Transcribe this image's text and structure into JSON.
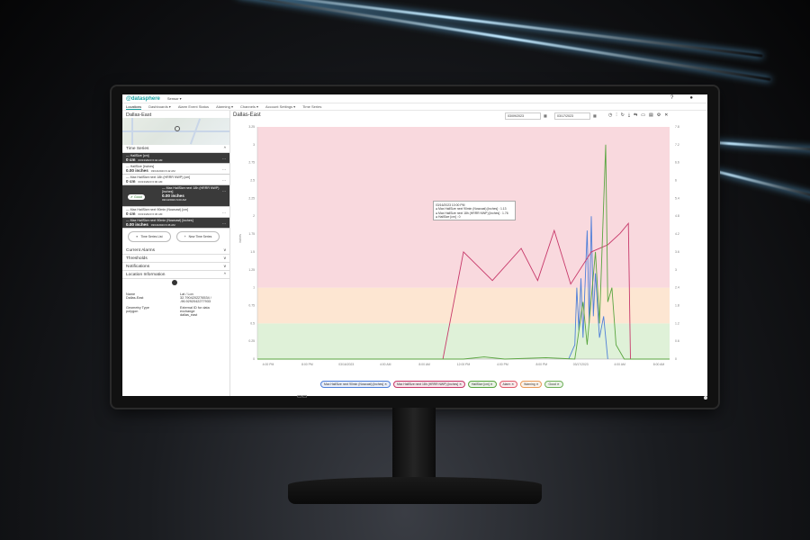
{
  "app": {
    "logo": "@datasphere",
    "sensor_select": "Sensor ▾",
    "help_icon": "?",
    "user_icon": "user-icon"
  },
  "nav": [
    "Locations",
    "Dashboards ▾",
    "Alarm Event Status",
    "Alarming ▾",
    "Channels ▾",
    "Account Settings ▾",
    "Time Series"
  ],
  "sidebar": {
    "location_title": "Dallas-East",
    "time_series_header": "Time Series",
    "items": [
      {
        "name": "— HailSize [cm]",
        "value": "0 cm",
        "time": "03/13/2023 6:42 AM",
        "dark": true
      },
      {
        "name": "— HailSize [inches]",
        "value": "0.00 inches",
        "time": "03/13/2023 6:42 AM",
        "dark": false
      },
      {
        "name": "— Max HailSize next 18h (HRRR NWP) [cm]",
        "value": "0 cm",
        "time": "03/13/2023 6:00 AM",
        "dark": false
      },
      {
        "name": "— Max HailSize next 18h (HRRR NWP) [inches]",
        "value": "0.00 inches",
        "time": "03/13/2023 6:00 AM",
        "dark": true,
        "badge": "Good"
      },
      {
        "name": "— Max HailSize next 90min (Nowcast) [cm]",
        "value": "0 cm",
        "time": "03/13/2023 6:36 AM",
        "dark": false
      },
      {
        "name": "— Max HailSize next 90min (Nowcast) [inches]",
        "value": "0.00 inches",
        "time": "03/13/2023 6:36 AM",
        "dark": true
      }
    ],
    "btn_list": "Time Series List",
    "btn_new": "New Time Series",
    "sections": [
      "Current Alarms",
      "Thresholds",
      "Notifications",
      "Location Information"
    ],
    "loc_info": {
      "name_label": "Name",
      "name_value": "Dallas-East",
      "latlon_label": "Lat / Lon",
      "latlon_value": "32.7904202276534 / -96.9292042277933",
      "geom_label": "Geometry Type",
      "geom_value": "polygon",
      "extid_label": "External ID for data exchange",
      "extid_value": "dallas_east"
    }
  },
  "main": {
    "title": "Dallas-East",
    "date_from": "03/09/2023",
    "date_to": "03/17/2023",
    "tooltip": {
      "line1": "03/16/2023 10:00 PM",
      "line2": "● Max HailSize next 90min (Nowcast) [inches] : 1.13",
      "line3": "● Max HailSize next 18h (HRRR NWP) [inches] : 1.76",
      "line4": "● HailSize [cm] : 0"
    }
  },
  "chart_data": {
    "type": "line",
    "x": [
      "4:00 PM",
      "8:00 PM",
      "03/16/2023",
      "4:00 AM",
      "8:00 AM",
      "12:00 PM",
      "4:00 PM",
      "8:00 PM",
      "03/17/2023",
      "4:00 AM",
      "8:00 AM"
    ],
    "left_y_ticks": [
      "0",
      "0.25",
      "0.5",
      "0.75",
      "1",
      "1.25",
      "1.5",
      "1.75",
      "2",
      "2.25",
      "2.5",
      "2.75",
      "3",
      "3.25"
    ],
    "right_y_ticks": [
      "0",
      "0.6",
      "1.2",
      "1.8",
      "2.4",
      "3",
      "3.6",
      "4.2",
      "4.8",
      "5.4",
      "6",
      "6.6",
      "7.2",
      "7.8"
    ],
    "ylabel": "inches",
    "bands": [
      {
        "name": "Good",
        "from": 0,
        "to": 0.5,
        "color": "#dff1d8"
      },
      {
        "name": "Warning",
        "from": 0.5,
        "to": 1,
        "color": "#fde6d2"
      },
      {
        "name": "Alarm",
        "from": 1,
        "to": 3.25,
        "color": "#f9d9de"
      }
    ],
    "series": [
      {
        "name": "Max HailSize next 90min (Nowcast) [inches]",
        "color": "#4f7fd8",
        "points": [
          [
            0.755,
            0
          ],
          [
            0.77,
            0.2
          ],
          [
            0.775,
            1.0
          ],
          [
            0.78,
            0.4
          ],
          [
            0.785,
            1.13
          ],
          [
            0.79,
            0.3
          ],
          [
            0.8,
            1.8
          ],
          [
            0.805,
            0.5
          ],
          [
            0.81,
            2.0
          ],
          [
            0.815,
            0.6
          ],
          [
            0.82,
            1.2
          ],
          [
            0.83,
            0.3
          ],
          [
            0.84,
            0.6
          ],
          [
            0.85,
            0
          ]
        ]
      },
      {
        "name": "Max HailSize next 18h (HRRR NWP) [inches]",
        "color": "#c7396a",
        "points": [
          [
            0.45,
            0
          ],
          [
            0.5,
            1.5
          ],
          [
            0.57,
            1.1
          ],
          [
            0.64,
            1.55
          ],
          [
            0.68,
            1.1
          ],
          [
            0.72,
            1.8
          ],
          [
            0.76,
            1.05
          ],
          [
            0.81,
            1.5
          ],
          [
            0.85,
            1.6
          ],
          [
            0.88,
            1.76
          ],
          [
            0.9,
            1.9
          ],
          [
            0.905,
            0
          ]
        ]
      },
      {
        "name": "HailSize [cm]",
        "color": "#5aa540",
        "points": [
          [
            0.0,
            0
          ],
          [
            0.5,
            0
          ],
          [
            0.55,
            0.03
          ],
          [
            0.6,
            0
          ],
          [
            0.7,
            0.02
          ],
          [
            0.77,
            0
          ],
          [
            0.79,
            0.8
          ],
          [
            0.8,
            0.2
          ],
          [
            0.82,
            1.5
          ],
          [
            0.83,
            0.5
          ],
          [
            0.845,
            3.0
          ],
          [
            0.85,
            0.8
          ],
          [
            0.86,
            1.0
          ],
          [
            0.87,
            0.2
          ],
          [
            0.89,
            0
          ],
          [
            1.0,
            0
          ]
        ]
      }
    ],
    "legend": [
      "Max HailSize next 90min (Nowcast) [inches]",
      "Max HailSize next 18h (HRRR NWP) [inches]",
      "HailSize [cm]",
      "Alarm",
      "Warning",
      "Good"
    ],
    "legend_colors": [
      "#4f7fd8",
      "#c7396a",
      "#5aa540",
      "#e05c6c",
      "#e89b5a",
      "#6fb05a"
    ]
  }
}
